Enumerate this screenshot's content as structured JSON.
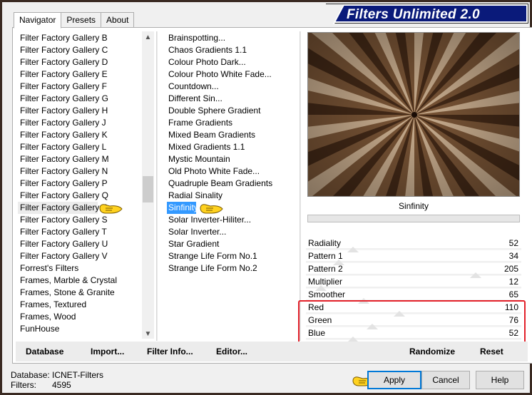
{
  "banner": {
    "title": "Filters Unlimited 2.0"
  },
  "tabs": [
    "Navigator",
    "Presets",
    "About"
  ],
  "categories": [
    "Filter Factory Gallery B",
    "Filter Factory Gallery C",
    "Filter Factory Gallery D",
    "Filter Factory Gallery E",
    "Filter Factory Gallery F",
    "Filter Factory Gallery G",
    "Filter Factory Gallery H",
    "Filter Factory Gallery J",
    "Filter Factory Gallery K",
    "Filter Factory Gallery L",
    "Filter Factory Gallery M",
    "Filter Factory Gallery N",
    "Filter Factory Gallery P",
    "Filter Factory Gallery Q",
    "Filter Factory Gallery R",
    "Filter Factory Gallery S",
    "Filter Factory Gallery T",
    "Filter Factory Gallery U",
    "Filter Factory Gallery V",
    "Forrest's Filters",
    "Frames, Marble & Crystal",
    "Frames, Stone & Granite",
    "Frames, Textured",
    "Frames, Wood",
    "FunHouse"
  ],
  "selected_category": "Filter Factory Gallery R",
  "filters": [
    "Brainspotting...",
    "Chaos Gradients 1.1",
    "Colour Photo Dark...",
    "Colour Photo White Fade...",
    "Countdown...",
    "Different Sin...",
    "Double Sphere Gradient",
    "Frame Gradients",
    "Mixed Beam Gradients",
    "Mixed Gradients 1.1",
    "Mystic Mountain",
    "Old Photo White Fade...",
    "Quadruple Beam Gradients",
    "Radial Sinality",
    "Sinfinity",
    "Solar Inverter-Hiliter...",
    "Solar Inverter...",
    "Star Gradient",
    "Strange Life Form No.1",
    "Strange Life Form No.2"
  ],
  "selected_filter": "Sinfinity",
  "preview": {
    "label": "Sinfinity"
  },
  "sliders": [
    {
      "name": "Radiality",
      "value": "52",
      "level": 52
    },
    {
      "name": "Pattern 1",
      "value": "34",
      "level": 34
    },
    {
      "name": "Pattern 2",
      "value": "205",
      "level": 205
    },
    {
      "name": "Multiplier",
      "value": "12",
      "level": 12
    },
    {
      "name": "Smoother",
      "value": "65",
      "level": 65
    },
    {
      "name": "Red",
      "value": "110",
      "level": 110
    },
    {
      "name": "Green",
      "value": "76",
      "level": 76
    },
    {
      "name": "Blue",
      "value": "52",
      "level": 52
    }
  ],
  "bottom_links": {
    "database": "Database",
    "import": "Import...",
    "filter_info": "Filter Info...",
    "editor": "Editor...",
    "randomize": "Randomize",
    "reset": "Reset"
  },
  "status": {
    "database_label": "Database:",
    "database_value": "ICNET-Filters",
    "filters_label": "Filters:",
    "filters_value": "4595"
  },
  "buttons": {
    "apply": "Apply",
    "cancel": "Cancel",
    "help": "Help"
  },
  "colors": {
    "selection": "#3399ff",
    "highlight_box": "#e3212a",
    "banner_bg": "#0a1a7a"
  },
  "icons": [
    "pointing-hand-icon",
    "scroll-up-icon",
    "scroll-down-icon"
  ]
}
